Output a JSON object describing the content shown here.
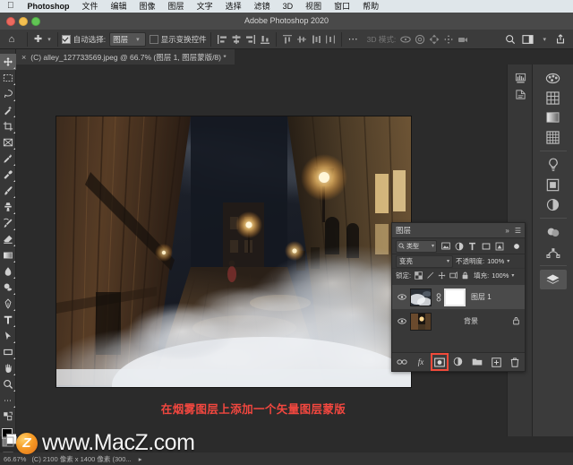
{
  "mac_menu": {
    "apple_icon": "apple-icon",
    "app_name": "Photoshop",
    "items": [
      "文件",
      "编辑",
      "图像",
      "图层",
      "文字",
      "选择",
      "滤镜",
      "3D",
      "视图",
      "窗口",
      "帮助"
    ]
  },
  "window": {
    "title": "Adobe Photoshop 2020",
    "close": "close-button",
    "minimize": "minimize-button",
    "zoom": "zoom-button"
  },
  "options_bar": {
    "home_icon": "home-icon",
    "tool_icon": "move-tool-icon",
    "auto_select_label": "自动选择:",
    "auto_select_checked": true,
    "auto_select_value": "图层",
    "show_transform_label": "显示变换控件",
    "show_transform_checked": false,
    "more_icon": "more-options-icon",
    "mode_3d_label": "3D 模式:",
    "search_icon": "search-icon",
    "workspace_icon": "workspace-icon",
    "share_icon": "share-icon"
  },
  "document_tab": {
    "close_icon": "close-tab-icon",
    "label": "(C) alley_127733569.jpeg @ 66.7% (图层 1, 图层蒙版/8) *"
  },
  "toolbar": {
    "tools": [
      {
        "name": "move-tool",
        "selected": true
      },
      {
        "name": "rectangular-marquee-tool",
        "selected": false
      },
      {
        "name": "lasso-tool",
        "selected": false
      },
      {
        "name": "quick-selection-tool",
        "selected": false
      },
      {
        "name": "crop-tool",
        "selected": false
      },
      {
        "name": "frame-tool",
        "selected": false
      },
      {
        "name": "eyedropper-tool",
        "selected": false
      },
      {
        "name": "healing-brush-tool",
        "selected": false
      },
      {
        "name": "brush-tool",
        "selected": false
      },
      {
        "name": "clone-stamp-tool",
        "selected": false
      },
      {
        "name": "history-brush-tool",
        "selected": false
      },
      {
        "name": "eraser-tool",
        "selected": false
      },
      {
        "name": "gradient-tool",
        "selected": false
      },
      {
        "name": "blur-tool",
        "selected": false
      },
      {
        "name": "dodge-tool",
        "selected": false
      },
      {
        "name": "pen-tool",
        "selected": false
      },
      {
        "name": "type-tool",
        "selected": false
      },
      {
        "name": "path-selection-tool",
        "selected": false
      },
      {
        "name": "shape-tool",
        "selected": false
      },
      {
        "name": "hand-tool",
        "selected": false
      },
      {
        "name": "zoom-tool",
        "selected": false
      },
      {
        "name": "edit-toolbar-tool",
        "selected": false
      }
    ],
    "foreground_color": "#000000",
    "background_color": "#ffffff",
    "quick_mask_icon": "quick-mask-icon"
  },
  "right_rail": {
    "collapsed_icons": [
      "histogram-icon",
      "history-icon"
    ],
    "items": [
      {
        "name": "color-panel-icon",
        "active": false
      },
      {
        "name": "swatches-panel-icon",
        "active": false
      },
      {
        "name": "gradients-panel-icon",
        "active": false
      },
      {
        "name": "patterns-panel-icon",
        "active": false
      },
      {
        "name": "learn-panel-icon",
        "active": false
      },
      {
        "name": "libraries-panel-icon",
        "active": false
      },
      {
        "name": "adjustments-panel-icon",
        "active": false
      },
      {
        "name": "3d-panel-icon",
        "active": false
      },
      {
        "name": "paths-panel-icon",
        "active": false
      },
      {
        "name": "layers-panel-icon",
        "active": true
      }
    ]
  },
  "layers_panel": {
    "title": "图层",
    "collapse_icon": "collapse-icon",
    "menu_icon": "panel-menu-icon",
    "filter": {
      "search_icon": "search-icon",
      "kind_label": "类型",
      "icons": [
        "filter-pixel-icon",
        "filter-adjustment-icon",
        "filter-type-icon",
        "filter-shape-icon",
        "filter-smartobject-icon"
      ],
      "toggle_icon": "filter-toggle-icon"
    },
    "blend_mode": "变亮",
    "opacity_label": "不透明度:",
    "opacity_value": "100%",
    "lock_label": "锁定:",
    "lock_icons": [
      "lock-transparent-icon",
      "lock-image-icon",
      "lock-position-icon",
      "lock-nesting-icon",
      "lock-all-icon"
    ],
    "fill_label": "填充:",
    "fill_value": "100%",
    "layers": [
      {
        "name": "图层 1",
        "visible": true,
        "selected": true,
        "has_mask": true,
        "mask_selected": true,
        "link_icon": "link-icon",
        "locked": false
      },
      {
        "name": "背景",
        "visible": true,
        "selected": false,
        "has_mask": false,
        "mask_selected": false,
        "locked": true,
        "lock_icon": "lock-icon"
      }
    ],
    "footer_buttons": [
      {
        "name": "link-layers-button",
        "highlighted": false
      },
      {
        "name": "layer-style-fx-button",
        "highlighted": false
      },
      {
        "name": "add-layer-mask-button",
        "highlighted": true
      },
      {
        "name": "new-adjustment-layer-button",
        "highlighted": false
      },
      {
        "name": "new-group-button",
        "highlighted": false
      },
      {
        "name": "new-layer-button",
        "highlighted": false
      },
      {
        "name": "delete-layer-button",
        "highlighted": false
      }
    ]
  },
  "annotation": {
    "text": "在烟雾图层上添加一个矢量图层蒙版",
    "color": "#f2473f"
  },
  "status_bar": {
    "zoom": "66.67%",
    "doc_info": "(C) 2100 像素 x 1400 像素 (300..."
  },
  "watermark": {
    "logo_letter": "Z",
    "text": "www.MacZ.com"
  }
}
